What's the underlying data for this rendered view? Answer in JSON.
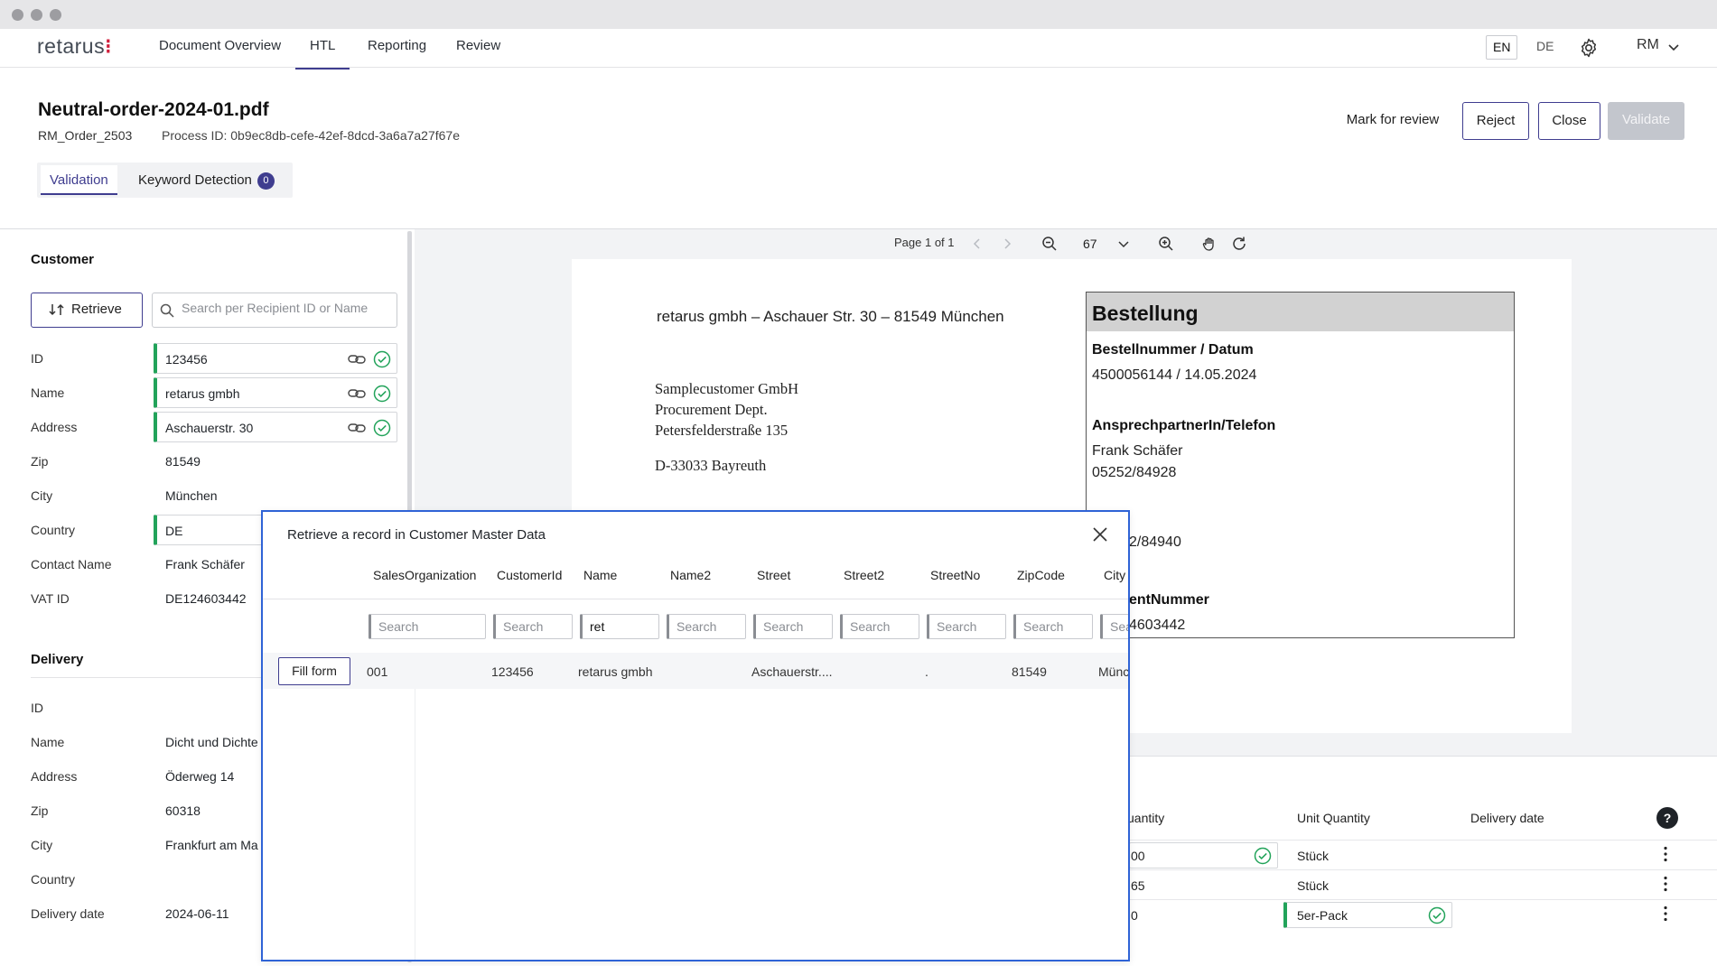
{
  "nav": {
    "logo": "retarus",
    "items": [
      "Document Overview",
      "HTL",
      "Reporting",
      "Review"
    ],
    "lang_en": "EN",
    "lang_de": "DE",
    "user": "RM"
  },
  "header": {
    "title": "Neutral-order-2024-01.pdf",
    "order_ref": "RM_Order_2503",
    "process_id": "Process ID: 0b9ec8db-cefe-42ef-8dcd-3a6a7a27f67e",
    "mark_for_review": "Mark for review",
    "reject": "Reject",
    "close": "Close",
    "validate": "Validate"
  },
  "tabs": {
    "validation": "Validation",
    "keyword_detection": "Keyword Detection",
    "keyword_count": "0"
  },
  "customer": {
    "title": "Customer",
    "retrieve": "Retrieve",
    "search_placeholder": "Search per Recipient ID or Name",
    "labels": {
      "id": "ID",
      "name": "Name",
      "address": "Address",
      "zip": "Zip",
      "city": "City",
      "country": "Country",
      "contact": "Contact Name",
      "vat": "VAT ID"
    },
    "values": {
      "id": "123456",
      "name": "retarus gmbh",
      "address": "Aschauerstr. 30",
      "zip": "81549",
      "city": "München",
      "country": "DE",
      "contact": "Frank Schäfer",
      "vat": "DE124603442"
    }
  },
  "delivery": {
    "title": "Delivery",
    "labels": {
      "id": "ID",
      "name": "Name",
      "address": "Address",
      "zip": "Zip",
      "city": "City",
      "country": "Country",
      "date": "Delivery date"
    },
    "values": {
      "name": "Dicht und Dichte",
      "address": "Öderweg 14",
      "zip": "60318",
      "city": "Frankfurt am Ma",
      "date": "2024-06-11"
    }
  },
  "viewer": {
    "page_info": "Page 1 of 1",
    "zoom": "67"
  },
  "document": {
    "sender_line": "retarus gmbh – Aschauer Str. 30 – 81549 München",
    "recipient": [
      "Samplecustomer GmbH",
      "Procurement Dept.",
      "Petersfelderstraße 135"
    ],
    "recipient_city": "D-33033 Bayreuth",
    "box_title": "Bestellung",
    "order_label": "Bestellnummer / Datum",
    "order_value": "4500056144 / 14.05.2024",
    "contact_label": "AnsprechpartnerIn/Telefon",
    "contact_name": "Frank Schäfer",
    "contact_phone": "05252/84928",
    "fax_fragment": "2/84940",
    "client_label_fragment": "entNummer",
    "client_value_fragment": "4603442"
  },
  "items_table": {
    "col_quantity": "uantity",
    "col_unit": "Unit Quantity",
    "col_delivery": "Delivery date",
    "help": "?",
    "rows": [
      {
        "qty": "00",
        "unit": "Stück"
      },
      {
        "qty": "65",
        "unit": "Stück"
      },
      {
        "qty": "0",
        "unit": "5er-Pack"
      }
    ]
  },
  "modal": {
    "title": "Retrieve a record in Customer Master Data",
    "columns": [
      "SalesOrganization",
      "CustomerId",
      "Name",
      "Name2",
      "Street",
      "Street2",
      "StreetNo",
      "ZipCode",
      "City"
    ],
    "search_placeholder": "Search",
    "name_filter": "ret",
    "fill_form": "Fill form",
    "row": {
      "sales_org": "001",
      "customer_id": "123456",
      "name": "retarus gmbh",
      "street": "Aschauerstr....",
      "street_no": ".",
      "zip": "81549",
      "city": "Münc"
    }
  }
}
